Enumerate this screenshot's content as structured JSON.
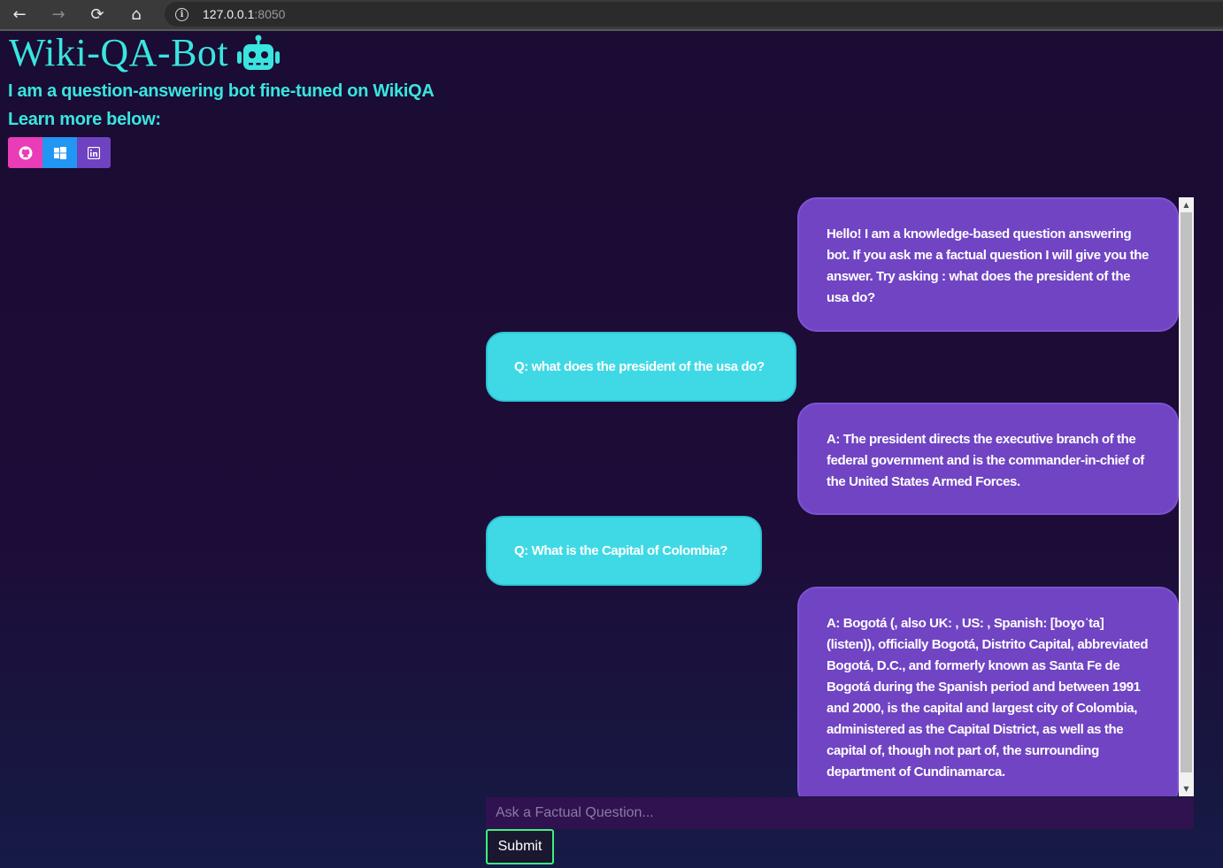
{
  "browser": {
    "back_icon": "←",
    "forward_icon": "→",
    "reload_icon": "⟳",
    "home_icon": "⌂",
    "info_icon": "i",
    "url_host": "127.0.0.1",
    "url_port": ":8050"
  },
  "header": {
    "title": "Wiki-QA-Bot",
    "robot_icon": "robot-icon",
    "subtitle": "I am a question-answering bot fine-tuned on WikiQA",
    "learn_more": "Learn more below:"
  },
  "links": {
    "github_icon": "github-icon",
    "windows_icon": "windows-icon",
    "linkedin_icon": "linkedin-icon",
    "github_color": "#e93cb6",
    "windows_color": "#2196f3",
    "linkedin_color": "#6f42c1"
  },
  "chat": {
    "messages": [
      {
        "role": "bot",
        "text": "Hello! I am a knowledge-based question answering bot. If you ask me a factual question I will give you the answer. Try asking : what does the president of the usa do?"
      },
      {
        "role": "user",
        "text": "Q: what does the president of the usa do?"
      },
      {
        "role": "bot",
        "text": "A: The president directs the executive branch of the federal government and is the commander-in-chief of the United States Armed Forces."
      },
      {
        "role": "user",
        "text": "Q: What is the Capital of Colombia?"
      },
      {
        "role": "bot",
        "text": "A: Bogotá (, also UK: , US: , Spanish: [boɣoˈta] (listen)), officially Bogotá, Distrito Capital, abbreviated Bogotá, D.C., and formerly known as Santa Fe de Bogotá during the Spanish period and between 1991 and 2000, is the capital and largest city of Colombia, administered as the Capital District, as well as the capital of, though not part of, the surrounding department of Cundinamarca."
      }
    ],
    "bot_color": "#7044c3",
    "user_color": "#3fd9e6"
  },
  "input": {
    "placeholder": "Ask a Factual Question...",
    "value": "",
    "submit_label": "Submit"
  }
}
